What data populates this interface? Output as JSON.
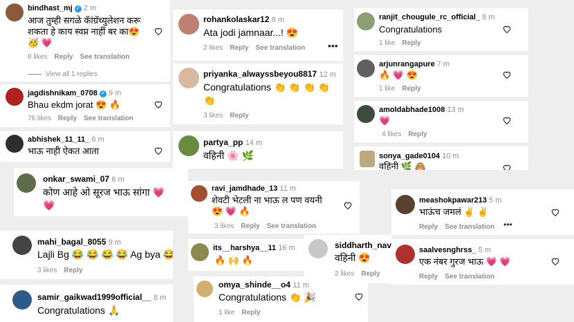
{
  "icons": {
    "heart": "heart-outline-icon",
    "more": "more-dots-icon",
    "verified": "verified-badge-icon"
  },
  "col1": [
    {
      "user": "bindhast_mj",
      "time": "2 m",
      "verified": true,
      "text": "आज तुम्ही सगळे कॅांग्रॅच्युलेशन करू",
      "text2": "शकता हे काय स्वप्न नाहीं बर का😍",
      "text3": "🥳 💗",
      "likes": "8 likes",
      "reply": "Reply",
      "translate": "See translation",
      "view": "View all 1 replies"
    },
    {
      "user": "jagdishnikam_0708",
      "time": "9 m",
      "verified": true,
      "text": "Bhau ekdm jorat 😍 🔥",
      "likes": "76 likes",
      "reply": "Reply",
      "translate": "See translation"
    },
    {
      "user": "abhishek_11_11_",
      "time": "6 m",
      "text": "भाऊ नाही ऐकत आता"
    },
    {
      "user": "onkar_swami_07",
      "time": "6 m",
      "text": "कोण आहे ओ सूरज भाऊ सांगा 💗",
      "text2": "💗"
    },
    {
      "user": "mahi_bagal_8055",
      "time": "9 m",
      "text": "Lajli Bg 😂 😂 😂 😂 Ag bya 😂",
      "likes": "3 likes",
      "reply": "Reply"
    },
    {
      "user": "samir_gaikwad1999official__",
      "time": "8 m",
      "text": "Congratulations 🙏"
    }
  ],
  "col2": [
    {
      "user": "rohankolaskar12",
      "time": "8 m",
      "text": "Ata jodi jamnaar...! 😍",
      "likes": "2 likes",
      "reply": "Reply",
      "translate": "See translation"
    },
    {
      "user": "priyanka_alwayssbeyou8817",
      "time": "12 m",
      "text": "Congratulations 👏 👏 👏 👏",
      "text2": "👏",
      "likes": "3 likes",
      "reply": "Reply"
    },
    {
      "user": "partya_pp",
      "time": "14 m",
      "text": "वहिनी 🌸 🌿"
    },
    {
      "user": "ravi_jamdhade_13",
      "time": "11 m",
      "text": "शेवटी भेटली ना भाऊ ल पण वयनी",
      "text2": "😍 💗 🔥",
      "likes": "3 likes",
      "reply": "Reply",
      "translate": "See translation"
    },
    {
      "user": "its__harshya__11",
      "time": "16 m",
      "text": "🔥 🙌 🔥"
    },
    {
      "user": "siddharth_nav",
      "text": "वहिनी 😍",
      "likes": "2 likes",
      "reply": "Reply"
    },
    {
      "user": "omya_shinde__o4",
      "time": "11 m",
      "text": "Congratulations 👏 🎉",
      "likes": "1 like",
      "reply": "Reply"
    }
  ],
  "col3": [
    {
      "user": "ranjit_chougule_rc_official_",
      "time": "8 m",
      "text": "Congratulations",
      "likes": "1 like",
      "reply": "Reply"
    },
    {
      "user": "arjunrangapure",
      "time": "7 m",
      "text": "🔥 💗 😍",
      "likes": "1 like",
      "reply": "Reply"
    },
    {
      "user": "amoldabhade1008",
      "time": "13 m",
      "text": "💗",
      "likes": "4 likes",
      "reply": "Reply"
    },
    {
      "user": "sonya_gade0104",
      "time": "10 m",
      "text": "वहिनी 🌿 🙈"
    },
    {
      "user": "meashokpawar213",
      "time": "5 m",
      "text": "भाऊंच जमलं ✌ ✌",
      "reply": "Reply",
      "translate": "See translation"
    },
    {
      "user": "saalvesnghrss_",
      "time": "5 m",
      "text": "एक नंबर गुरज भाऊ 💗 💗",
      "reply": "Reply",
      "translate": "See translation"
    }
  ]
}
